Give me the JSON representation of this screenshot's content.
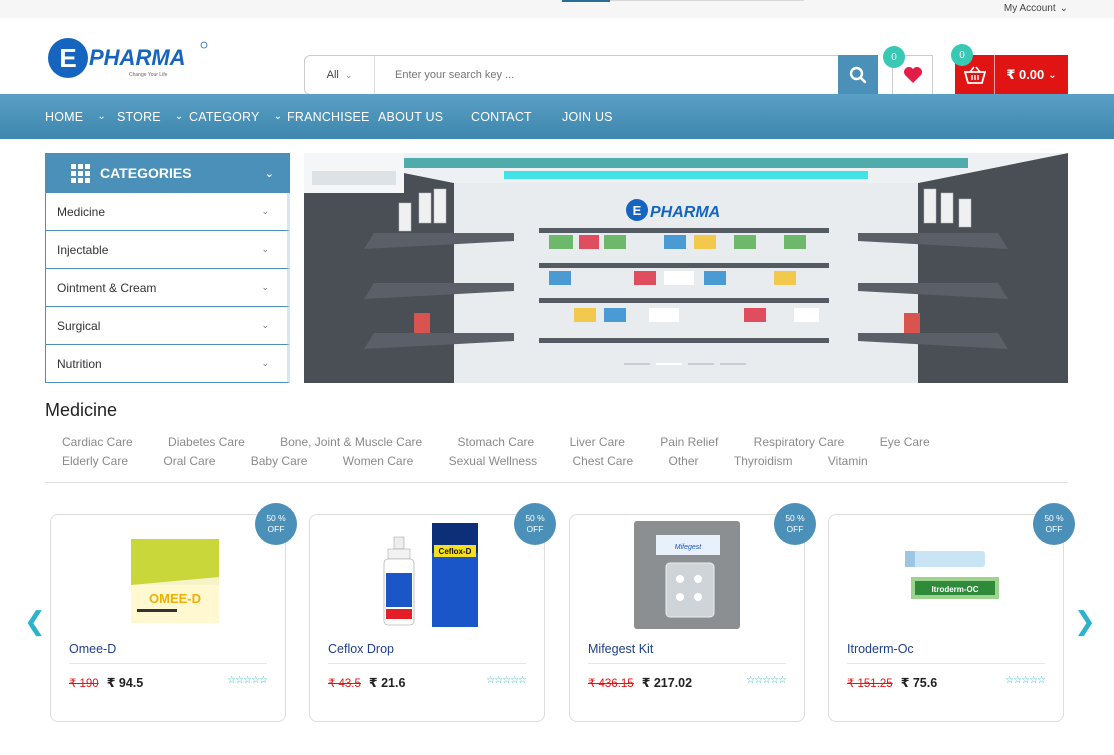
{
  "topbar": {
    "account_label": "My Account"
  },
  "brand": {
    "logo_text": "PHARMA",
    "logo_letter": "E",
    "tagline": "Change Your Life"
  },
  "search": {
    "category": "All",
    "placeholder": "Enter your search key ..."
  },
  "wishlist": {
    "count": "0"
  },
  "cart": {
    "count": "0",
    "total": "₹ 0.00"
  },
  "nav": [
    {
      "label": "HOME"
    },
    {
      "label": "STORE"
    },
    {
      "label": "CATEGORY"
    },
    {
      "label": "FRANCHISEE"
    },
    {
      "label": "ABOUT US"
    },
    {
      "label": "CONTACT"
    },
    {
      "label": "JOIN US"
    }
  ],
  "categories": {
    "title": "CATEGORIES",
    "items": [
      "Medicine",
      "Injectable",
      "Ointment & Cream",
      "Surgical",
      "Nutrition"
    ]
  },
  "banner": {
    "shelf_sign": "PHARMA"
  },
  "section": {
    "title": "Medicine",
    "links": [
      "Cardiac Care",
      "Diabetes Care",
      "Bone, Joint & Muscle Care",
      "Stomach Care",
      "Liver Care",
      "Pain Relief",
      "Respiratory Care",
      "Eye Care",
      "Elderly Care",
      "Oral Care",
      "Baby Care",
      "Women Care",
      "Sexual Wellness",
      "Chest Care",
      "Other",
      "Thyroidism",
      "Vitamin"
    ]
  },
  "products": [
    {
      "name": "Omee-D",
      "old_price": "₹ 190",
      "price": "₹ 94.5",
      "discount_line1": "50 %",
      "discount_line2": "OFF",
      "box_text": "OMEE-D"
    },
    {
      "name": "Ceflox Drop",
      "old_price": "₹ 43.5",
      "price": "₹ 21.6",
      "discount_line1": "50 %",
      "discount_line2": "OFF",
      "box_text": "Ceflox-D"
    },
    {
      "name": "Mifegest Kit",
      "old_price": "₹ 436.15",
      "price": "₹ 217.02",
      "discount_line1": "50 %",
      "discount_line2": "OFF",
      "box_text": "Mifegest"
    },
    {
      "name": "Itroderm-Oc",
      "old_price": "₹ 151.25",
      "price": "₹ 75.6",
      "discount_line1": "50 %",
      "discount_line2": "OFF",
      "box_text": "Itroderm-OC"
    }
  ],
  "carousel": {
    "prev": "❮",
    "next": "❯"
  },
  "colors": {
    "primary": "#4b90b8",
    "accent": "#e11414",
    "badge": "#38c9b5",
    "stars": "#2bb3c9"
  }
}
